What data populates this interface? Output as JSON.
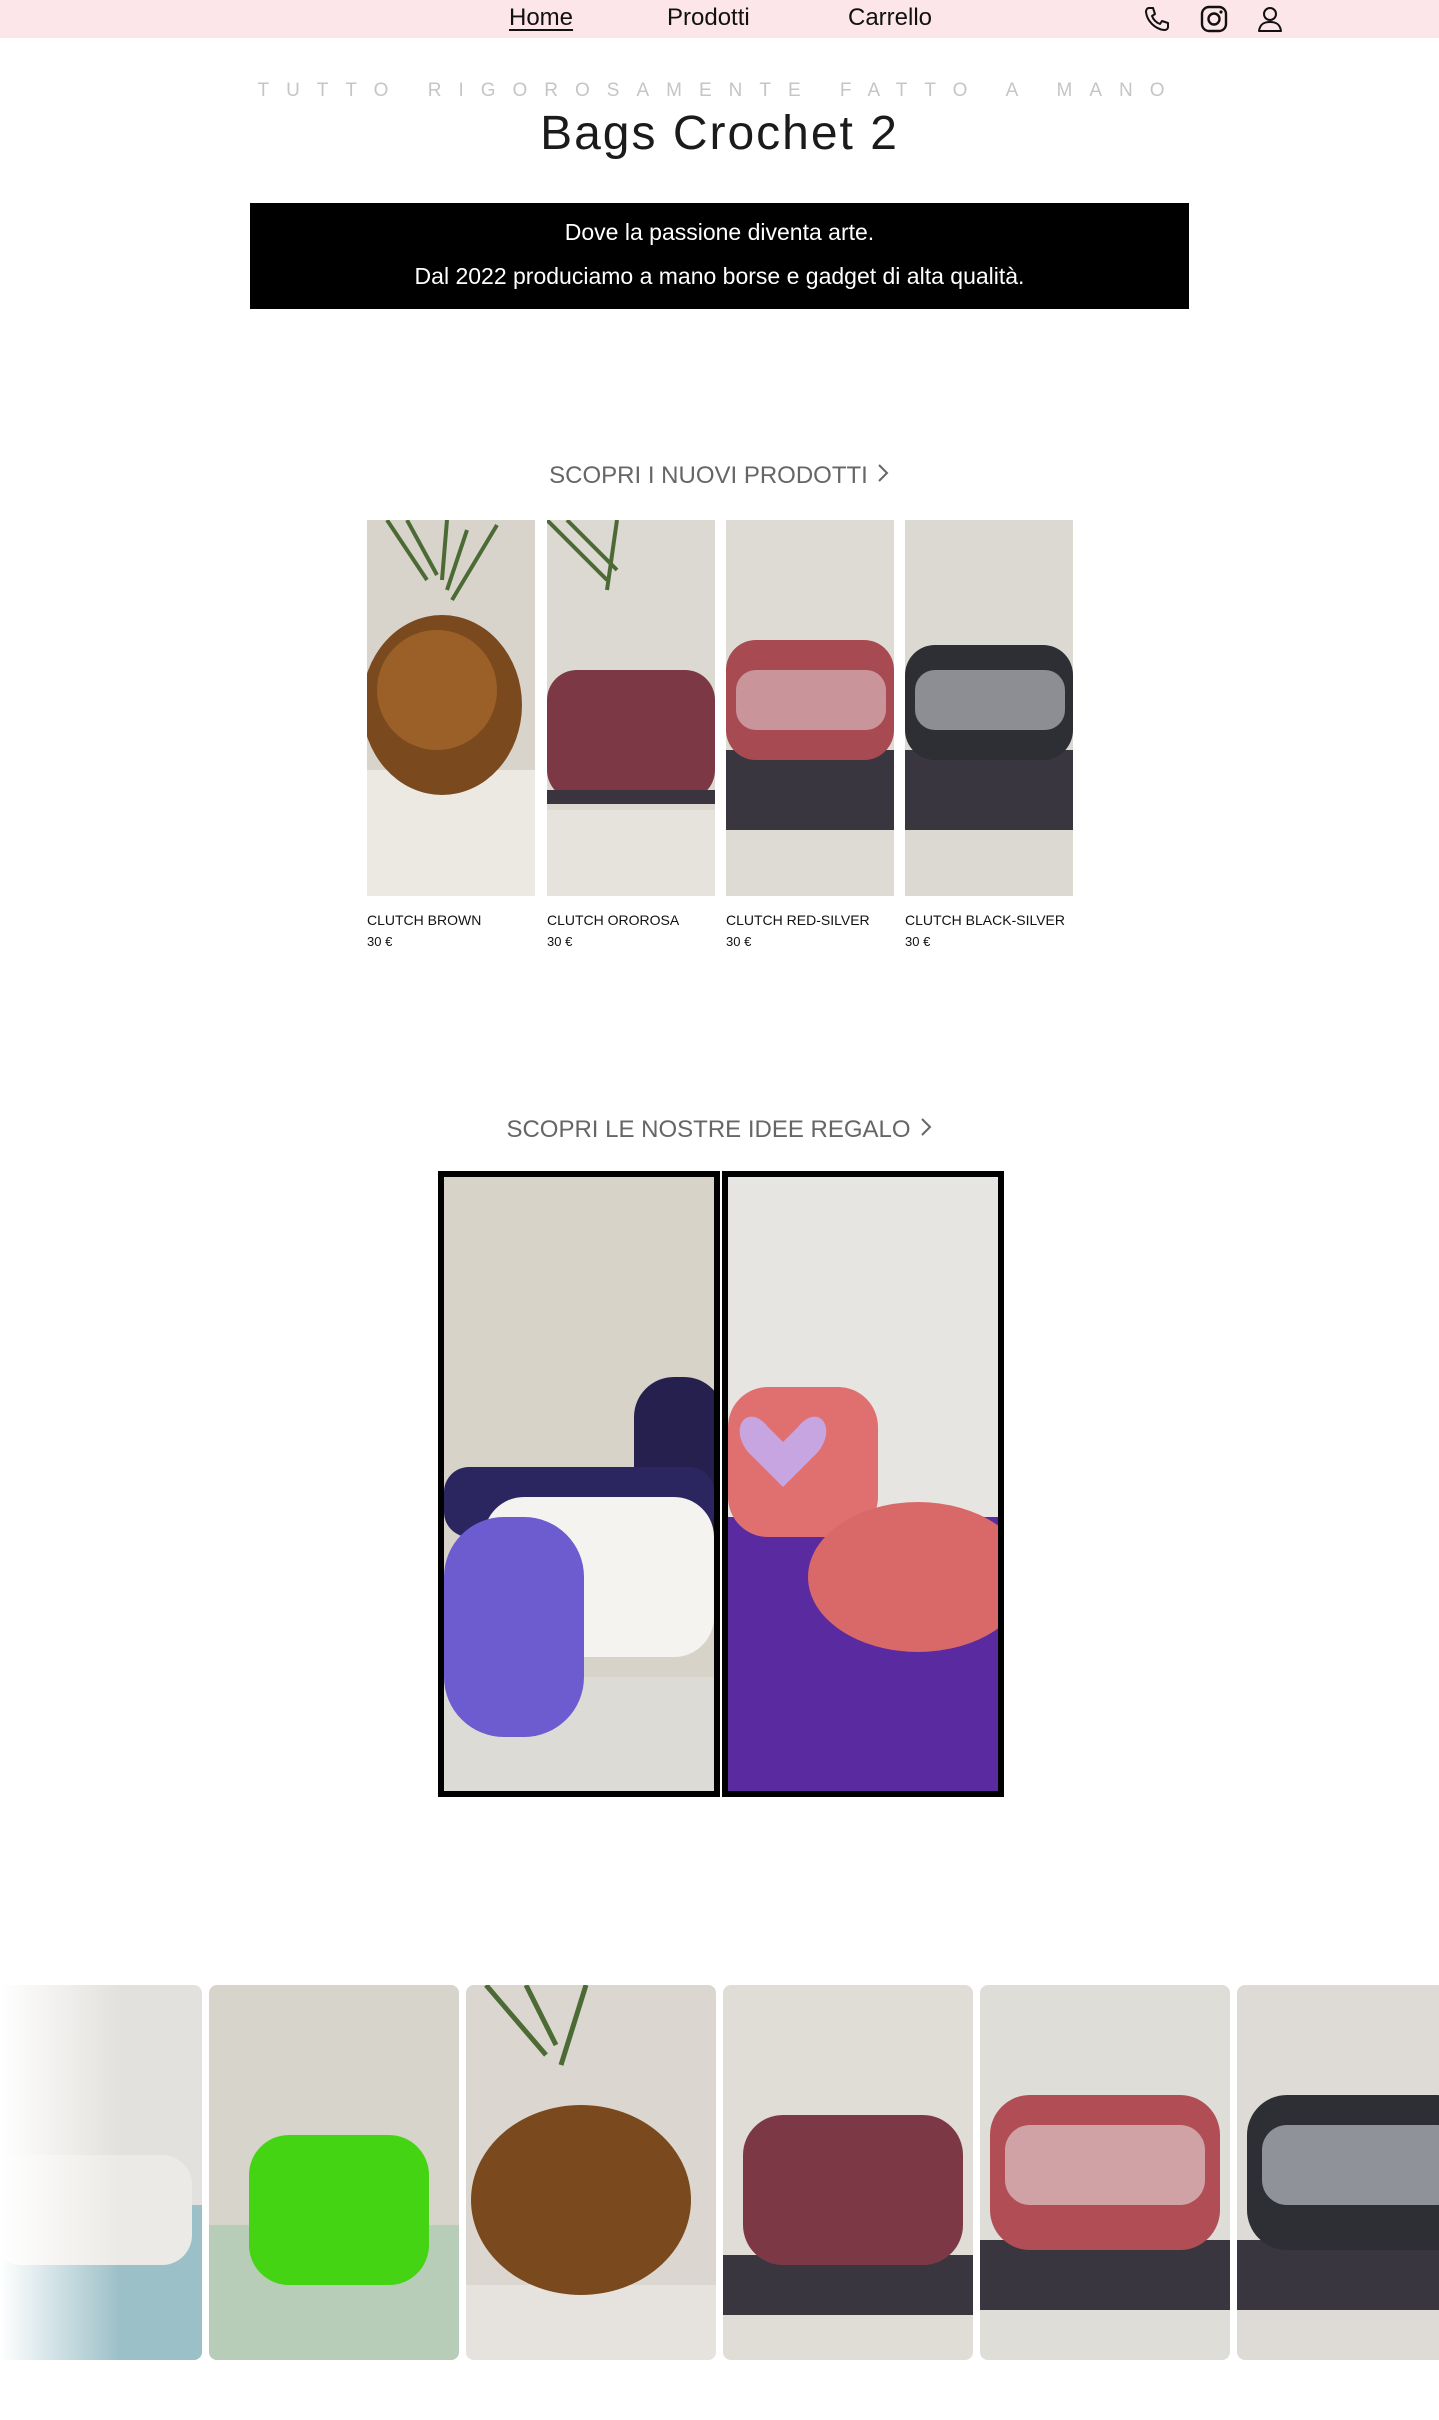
{
  "nav": {
    "links": [
      "Home",
      "Prodotti",
      "Carrello"
    ],
    "icons": [
      "phone-icon",
      "instagram-icon",
      "user-icon"
    ]
  },
  "header": {
    "tagline": "TUTTO RIGOROSAMENTE FATTO A MANO",
    "title": "Bags Crochet 2"
  },
  "banner": {
    "line1": "Dove la passione diventa arte.",
    "line2": "Dal 2022 produciamo a mano borse e gadget di alta qualità."
  },
  "new_products": {
    "heading": "SCOPRI I NUOVI PRODOTTI",
    "items": [
      {
        "name": "CLUTCH BROWN",
        "price": "30 €"
      },
      {
        "name": "CLUTCH ORO­ROSA",
        "price": "30 €"
      },
      {
        "name": "CLUTCH RED-SILVER",
        "price": "30 €"
      },
      {
        "name": "CLUTCH BLACK-SILVER",
        "price": "30 €"
      }
    ]
  },
  "gift_ideas": {
    "heading": "SCOPRI LE NOSTRE IDEE REGALO"
  },
  "colors": {
    "nav_bg": "#fde6ea",
    "banner_bg": "#000000",
    "banner_text": "#ffffff",
    "section_heading": "#666666"
  }
}
